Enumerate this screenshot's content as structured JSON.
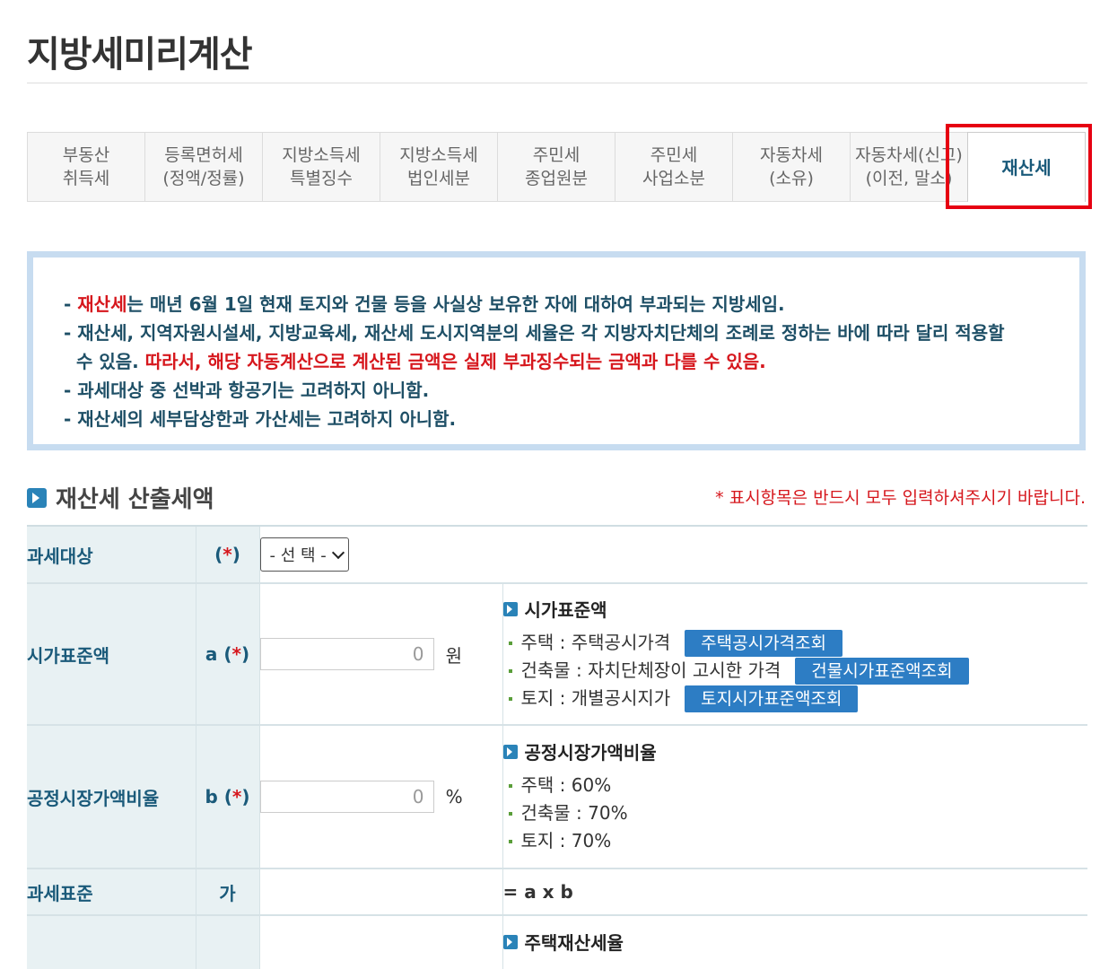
{
  "page": {
    "title": "지방세미리계산"
  },
  "tabs": [
    {
      "label": "부동산\n취득세"
    },
    {
      "label": "등록면허세\n(정액/정률)"
    },
    {
      "label": "지방소득세\n특별징수"
    },
    {
      "label": "지방소득세\n법인세분"
    },
    {
      "label": "주민세\n종업원분"
    },
    {
      "label": "주민세\n사업소분"
    },
    {
      "label": "자동차세\n(소유)"
    },
    {
      "label": "자동차세(신고)\n(이전, 말소)"
    },
    {
      "label": "재산세"
    }
  ],
  "notice": {
    "line1_highlight": "재산세",
    "line1_rest": "는 매년 6월 1일 현재 토지와 건물 등을 사실상 보유한 자에 대하여 부과되는 지방세임.",
    "line2a": "재산세, 지역자원시설세, 지방교육세, 재산세 도시지역분의 세율은 각 지방자치단체의 조례로 정하는 바에 따라 달리 적용할",
    "line2b": "수 있음.",
    "line2_red": "따라서, 해당 자동계산으로 계산된 금액은 실제 부과징수되는 금액과 다를 수 있음.",
    "line3": "과세대상 중 선박과 항공기는 고려하지 아니함.",
    "line4": "재산세의 세부담상한과 가산세는 고려하지 아니함."
  },
  "section": {
    "title": "재산세 산출세액",
    "required_note": "* 표시항목은 반드시 모두 입력하셔주시기 바랍니다."
  },
  "form": {
    "row1": {
      "label": "과세대상",
      "sym_star": "*",
      "select_value": "- 선 택 -"
    },
    "row2": {
      "label": "시가표준액",
      "sym": "a",
      "sym_star": "*",
      "placeholder": "0",
      "unit": "원",
      "info_title": "시가표준액",
      "items": [
        {
          "text": "주택 : 주택공시가격",
          "button": "주택공시가격조회"
        },
        {
          "text": "건축물 : 자치단체장이 고시한 가격",
          "button": "건물시가표준액조회"
        },
        {
          "text": "토지 : 개별공시지가",
          "button": "토지시가표준액조회"
        }
      ]
    },
    "row3": {
      "label": "공정시장가액비율",
      "sym": "b",
      "sym_star": "*",
      "placeholder": "0",
      "unit": "%",
      "info_title": "공정시장가액비율",
      "items": [
        "주택 : 60%",
        "건축물 : 70%",
        "토지 : 70%"
      ]
    },
    "row4": {
      "label": "과세표준",
      "sym": "가",
      "formula": "= a x b"
    },
    "row5": {
      "info_title": "주택재산세율"
    }
  }
}
